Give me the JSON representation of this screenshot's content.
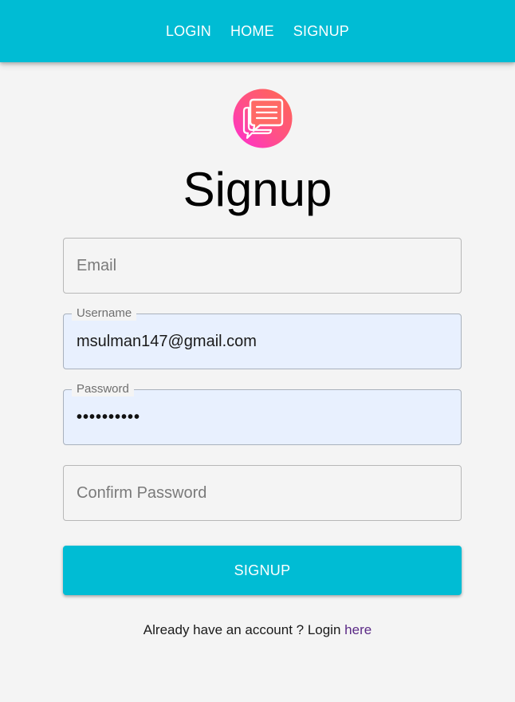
{
  "nav": {
    "links": [
      "LOGIN",
      "HOME",
      "SIGNUP"
    ]
  },
  "logo": {
    "icon": "chat-bubble-logo-icon"
  },
  "page": {
    "title": "Signup"
  },
  "form": {
    "email": {
      "placeholder": "Email",
      "value": ""
    },
    "username": {
      "label": "Username",
      "value": "msulman147@gmail.com"
    },
    "password": {
      "label": "Password",
      "value": "••••••••••"
    },
    "confirm_password": {
      "placeholder": "Confirm Password",
      "value": ""
    },
    "submit_label": "SIGNUP"
  },
  "footer": {
    "prompt": "Already have an account ? Login",
    "link": "here"
  },
  "colors": {
    "appbar": "#00bcd4",
    "button": "#00bcd4",
    "background": "#f4f4f4",
    "autofill": "#e8f0fe",
    "link": "#5b2a86"
  }
}
